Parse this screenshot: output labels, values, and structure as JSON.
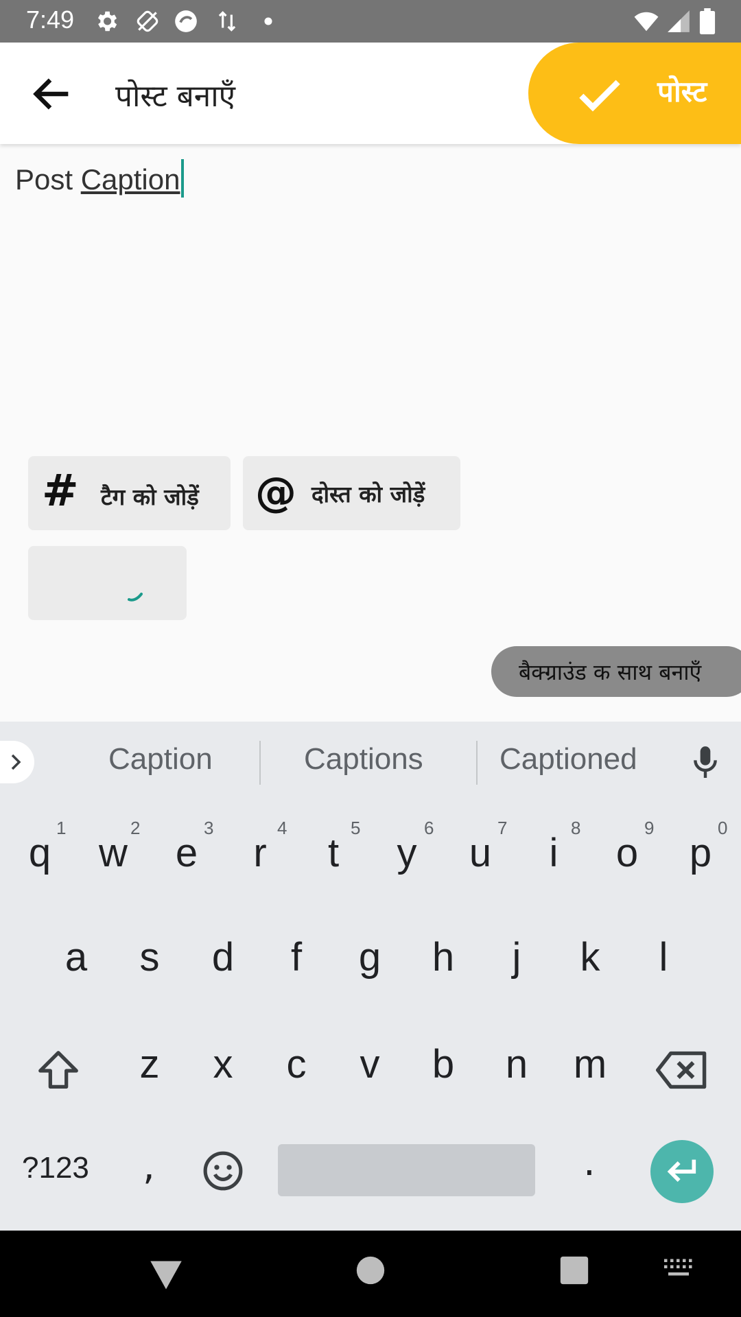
{
  "status_bar": {
    "time": "7:49"
  },
  "app_bar": {
    "title": "पोस्ट बनाएँ",
    "post_label": "पोस्ट",
    "accent": "#fdbe16"
  },
  "caption": {
    "word1": "Post ",
    "word2": "Caption"
  },
  "chips": {
    "tag_glyph": "#",
    "tag_label": "टैग को जोड़ें",
    "mention_glyph": "@",
    "mention_label": "दोस्त को जोड़ें"
  },
  "background_button": "बैक्ग्राउंड क साथ बनाएँ",
  "suggestions": [
    "Caption",
    "Captions",
    "Captioned"
  ],
  "keyboard": {
    "row1": [
      "q",
      "w",
      "e",
      "r",
      "t",
      "y",
      "u",
      "i",
      "o",
      "p"
    ],
    "row1_hints": [
      "1",
      "2",
      "3",
      "4",
      "5",
      "6",
      "7",
      "8",
      "9",
      "0"
    ],
    "row2": [
      "a",
      "s",
      "d",
      "f",
      "g",
      "h",
      "j",
      "k",
      "l"
    ],
    "row3": [
      "z",
      "x",
      "c",
      "v",
      "b",
      "n",
      "m"
    ],
    "symbols_label": "?123",
    "comma": ",",
    "period": ".",
    "enter_color": "#4db6ac"
  }
}
